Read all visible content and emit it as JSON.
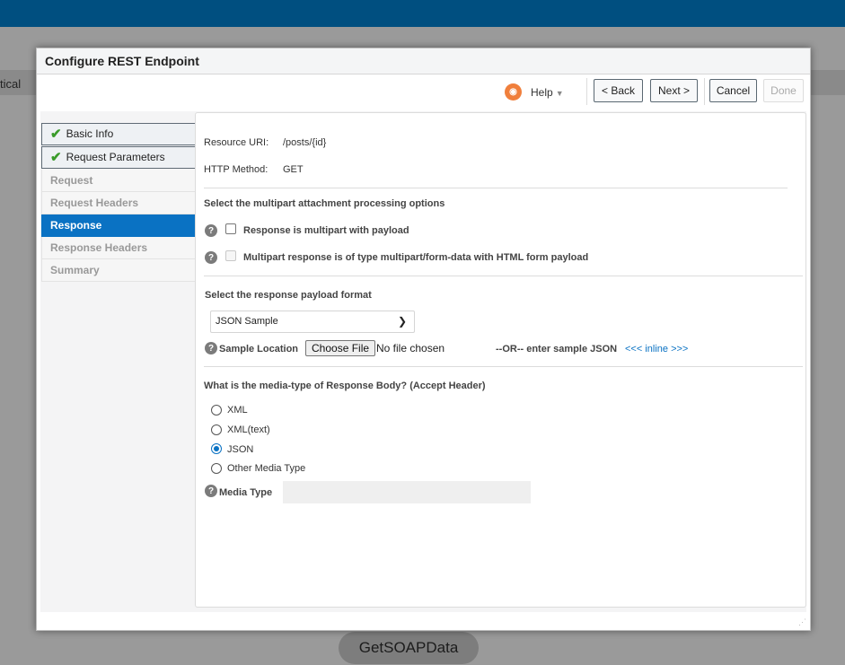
{
  "background": {
    "partial_label": "tical",
    "node_label": "GetSOAPData"
  },
  "dialog": {
    "title": "Configure REST Endpoint"
  },
  "toolbar": {
    "help_label": "Help",
    "back_label": "< Back",
    "next_label": "Next >",
    "cancel_label": "Cancel",
    "done_label": "Done"
  },
  "nav": {
    "items": [
      {
        "label": "Basic Info",
        "state": "completed"
      },
      {
        "label": "Request Parameters",
        "state": "completed"
      },
      {
        "label": "Request",
        "state": "disabled"
      },
      {
        "label": "Request Headers",
        "state": "disabled"
      },
      {
        "label": "Response",
        "state": "active"
      },
      {
        "label": "Response Headers",
        "state": "disabled"
      },
      {
        "label": "Summary",
        "state": "disabled"
      }
    ]
  },
  "content": {
    "resource_uri_label": "Resource URI:",
    "resource_uri_value": "/posts/{id}",
    "http_method_label": "HTTP Method:",
    "http_method_value": "GET",
    "multipart_heading": "Select the multipart attachment processing options",
    "multipart_option1": "Response is multipart with payload",
    "multipart_option2": "Multipart response is of type multipart/form-data with HTML form payload",
    "payload_heading": "Select the response payload format",
    "payload_format_selected": "JSON Sample",
    "sample_location_label": "Sample Location",
    "choose_file_label": "Choose File",
    "no_file_label": "No file chosen",
    "or_label": "--OR-- enter sample JSON",
    "inline_link": "<<< inline >>>",
    "media_heading": "What is the media-type of Response Body? (Accept Header)",
    "media_options": [
      {
        "label": "XML",
        "checked": false
      },
      {
        "label": "XML(text)",
        "checked": false
      },
      {
        "label": "JSON",
        "checked": true
      },
      {
        "label": "Other Media Type",
        "checked": false
      }
    ],
    "media_type_label": "Media Type",
    "media_type_value": ""
  },
  "colors": {
    "topbar": "#004f80",
    "accent": "#0a72c3",
    "check": "#3a9b2a"
  }
}
